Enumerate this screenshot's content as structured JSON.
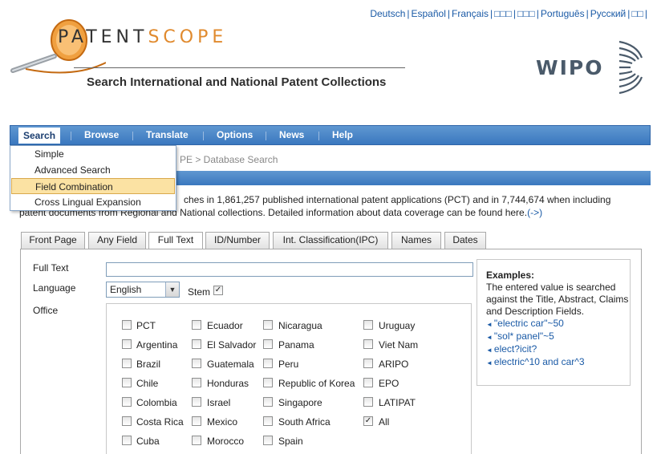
{
  "languages": [
    "Deutsch",
    "Español",
    "Français",
    "□□□",
    "□□□",
    "Português",
    "Русский",
    "□□"
  ],
  "logo": {
    "word_prefix": "P",
    "word_rest": "ATENT",
    "word_scope": "SCOPE",
    "subtitle": "Search International and National Patent Collections"
  },
  "wipo": {
    "text": "WIPO"
  },
  "nav": [
    "Search",
    "Browse",
    "Translate",
    "Options",
    "News",
    "Help"
  ],
  "search_menu": [
    "Simple",
    "Advanced Search",
    "Field Combination",
    "Cross Lingual Expansion"
  ],
  "breadcrumb": "PE  > Database Search",
  "intro": {
    "line1": "ches in 1,861,257 published international patent applications (PCT) and in 7,744,674 when including",
    "line2": "patent documents from Regional and National collections. Detailed information about data coverage can be found here.",
    "link": "(->)"
  },
  "tabs": [
    "Front Page",
    "Any Field",
    "Full Text",
    "ID/Number",
    "Int. Classification(IPC)",
    "Names",
    "Dates"
  ],
  "form": {
    "full_text_label": "Full Text",
    "full_text_value": "",
    "language_label": "Language",
    "language_value": "English",
    "stem_label": "Stem",
    "office_label": "Office"
  },
  "offices": [
    [
      "PCT",
      "Ecuador",
      "Nicaragua",
      "Uruguay"
    ],
    [
      "Argentina",
      "El Salvador",
      "Panama",
      "Viet Nam"
    ],
    [
      "Brazil",
      "Guatemala",
      "Peru",
      "ARIPO"
    ],
    [
      "Chile",
      "Honduras",
      "Republic of Korea",
      "EPO"
    ],
    [
      "Colombia",
      "Israel",
      "Singapore",
      "LATIPAT"
    ],
    [
      "Costa Rica",
      "Mexico",
      "South Africa",
      "All"
    ],
    [
      "Cuba",
      "Morocco",
      "Spain",
      ""
    ]
  ],
  "examples": {
    "heading": "Examples:",
    "desc": "The entered value is searched against the Title, Abstract, Claims and Description Fields.",
    "items": [
      "\"electric car\"~50",
      "\"sol* panel\"~5",
      "elect?icit?",
      "electric^10 and car^3"
    ]
  },
  "colors": {
    "nav_blue": "#3a78bf",
    "link": "#1a5aa6",
    "accent_orange": "#e08a2e",
    "menu_highlight": "#fbe2a3"
  }
}
